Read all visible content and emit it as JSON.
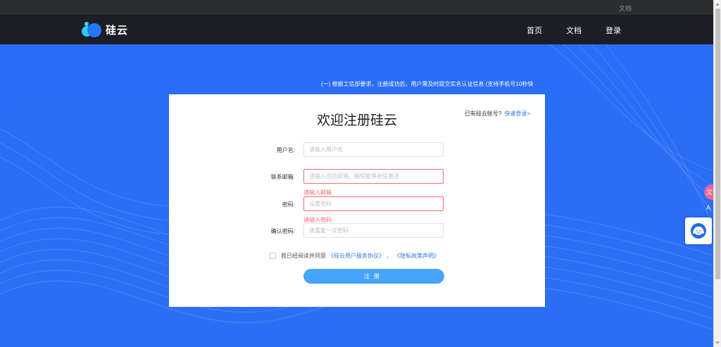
{
  "topbar": {
    "doc_link": "文档"
  },
  "navbar": {
    "logo_text": "硅云",
    "items": [
      {
        "label": "首页"
      },
      {
        "label": "文档"
      },
      {
        "label": "登录"
      }
    ]
  },
  "notice": "(一) 根据工信部要求，注册成功后，用户需及时提交实名认证信息 (支持手机号10秒快",
  "form": {
    "title": "欢迎注册硅云",
    "login_hint": "已有硅云账号?",
    "login_link": "快速登录>",
    "username_label": "用户名:",
    "username_placeholder": "请输入用户名",
    "email_label": "联系邮箱:",
    "email_placeholder": "请输入您的邮箱，确保能够收信激活",
    "email_error": "请输入邮箱",
    "password_label": "密码:",
    "password_placeholder": "设置密码",
    "password_error": "请输入密码",
    "confirm_label": "确认密码:",
    "confirm_placeholder": "请重复一次密码",
    "agree_text": "我已经阅读并同意",
    "agreement_link": "《硅云用户服务协议》",
    "separator": "、",
    "privacy_link": "《隐私政策声明》",
    "submit_label": "注册"
  },
  "widgets": {
    "translate_glyph": "文A"
  },
  "colors": {
    "brand_blue": "#2a6cf5",
    "button_blue": "#46a5fb",
    "link_blue": "#2c7be5",
    "error_red": "#f56c6c",
    "nav_dark": "#1b1e24"
  }
}
